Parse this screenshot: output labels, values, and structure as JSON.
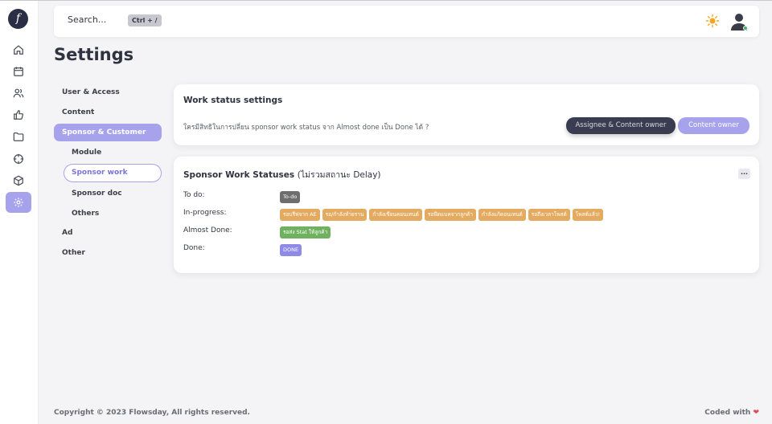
{
  "colors": {
    "accent": "#a7a2ec",
    "dark_button": "#3a3d52",
    "tag_orange": "#e4ab60",
    "tag_green": "#6fb15f",
    "tag_gray": "#6e6e6e",
    "tag_purple": "#8f8ae6",
    "online": "#3bb36b",
    "heart": "#e04a57"
  },
  "rail": {
    "logo": "f",
    "items": [
      {
        "icon": "home-icon"
      },
      {
        "icon": "calendar-icon"
      },
      {
        "icon": "users-icon"
      },
      {
        "icon": "thumbs-up-icon"
      },
      {
        "icon": "folder-icon"
      },
      {
        "icon": "crosshair-icon"
      },
      {
        "icon": "box-icon"
      },
      {
        "icon": "gear-icon",
        "active": true
      }
    ]
  },
  "topbar": {
    "search_placeholder": "Search...",
    "shortcut": "Ctrl + /",
    "theme_icon": "sun-icon",
    "avatar_icon": "user-avatar-icon"
  },
  "page": {
    "title": "Settings"
  },
  "settings_nav": {
    "items": [
      "User & Access",
      "Content",
      "Sponsor & Customer",
      "Ad",
      "Other"
    ],
    "sub_items": [
      "Module",
      "Sponsor work",
      "Sponsor doc",
      "Others"
    ],
    "active_item": "Sponsor & Customer",
    "active_sub_item": "Sponsor work"
  },
  "work_status_settings": {
    "title": "Work status settings",
    "question": "ใครมีสิทธิในการปลี่ยน sponsor work status จาก Almost done เป็น Done ได้ ?",
    "option_1": "Assignee & Content owner",
    "option_2": "Content owner"
  },
  "sponsor_statuses": {
    "title": "Sponsor Work Statuses",
    "subtitle": "(ไม่รวมสถานะ Delay)",
    "more": "...",
    "rows": [
      {
        "label": "To do:",
        "tags": [
          "To-do"
        ]
      },
      {
        "label": "In-progress:",
        "tags": [
          "รอบรีฟจาก AE",
          "รอ/กำลังทำ่ยราน",
          "กำลังเขียนคอนเทนต์",
          "รอฟีดแบคจากลูกค้า",
          "กำลังแก้คอนเทนต์",
          "รอถึงเวลาโพสต์",
          "โพสต์แล้ว!"
        ]
      },
      {
        "label": "Almost Done:",
        "tags": [
          "รอส่ง Stat ให้ลูกค้า"
        ]
      },
      {
        "label": "Done:",
        "tags": [
          "DONE"
        ]
      }
    ]
  },
  "footer": {
    "copyright": "Copyright © 2023 Flowsday, All rights reserved.",
    "coded_with": "Coded with"
  }
}
